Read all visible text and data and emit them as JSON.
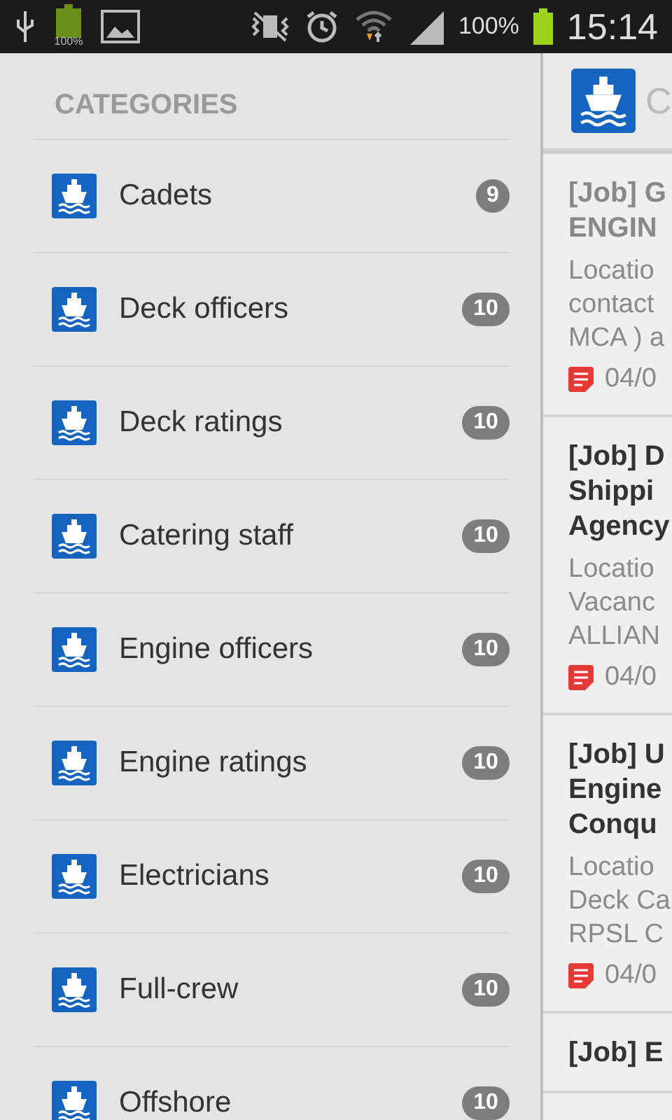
{
  "status_bar": {
    "usb_battery_label": "100%",
    "battery": "100%",
    "time": "15:14"
  },
  "drawer": {
    "heading": "CATEGORIES",
    "items": [
      {
        "label": "Cadets",
        "count": "9"
      },
      {
        "label": "Deck officers",
        "count": "10"
      },
      {
        "label": "Deck ratings",
        "count": "10"
      },
      {
        "label": "Catering staff",
        "count": "10"
      },
      {
        "label": "Engine officers",
        "count": "10"
      },
      {
        "label": "Engine ratings",
        "count": "10"
      },
      {
        "label": "Electricians",
        "count": "10"
      },
      {
        "label": "Full-crew",
        "count": "10"
      },
      {
        "label": "Offshore",
        "count": "10"
      }
    ]
  },
  "content": {
    "title": "C",
    "posts": [
      {
        "read": true,
        "title_lines": [
          "[Job] G",
          "ENGIN"
        ],
        "excerpt_lines": [
          "Locatio",
          "contact",
          "MCA ) a"
        ],
        "date": "04/0"
      },
      {
        "read": false,
        "title_lines": [
          "[Job] D",
          "Shippi",
          "Agency"
        ],
        "excerpt_lines": [
          "Locatio",
          "Vacanc",
          "ALLIAN"
        ],
        "date": "04/0"
      },
      {
        "read": false,
        "title_lines": [
          "[Job] U",
          "Engine",
          "Conqu"
        ],
        "excerpt_lines": [
          "Locatio",
          "Deck Ca",
          "RPSL C"
        ],
        "date": "04/0"
      },
      {
        "read": false,
        "title_lines": [
          "[Job] E"
        ]
      }
    ]
  }
}
